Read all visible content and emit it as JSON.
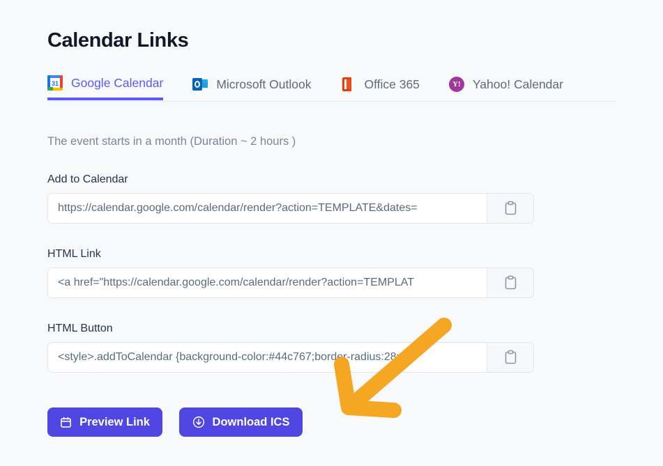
{
  "page": {
    "title": "Calendar Links",
    "background_color": "#f8f9fb",
    "accent_color": "#5b5bf2",
    "button_color": "#5046e4",
    "annotation_color": "#f5a623"
  },
  "tabs": [
    {
      "label": "Google Calendar",
      "icon": "google-calendar-icon",
      "active": true
    },
    {
      "label": "Microsoft Outlook",
      "icon": "microsoft-outlook-icon",
      "active": false
    },
    {
      "label": "Office 365",
      "icon": "office-365-icon",
      "active": false
    },
    {
      "label": "Yahoo! Calendar",
      "icon": "yahoo-calendar-icon",
      "active": false
    }
  ],
  "description": "The event starts in a month (Duration ~ 2 hours )",
  "fields": [
    {
      "label": "Add to Calendar",
      "value": "https://calendar.google.com/calendar/render?action=TEMPLATE&dates=",
      "copy_icon": "clipboard-icon"
    },
    {
      "label": "HTML Link",
      "value": "<a href=\"https://calendar.google.com/calendar/render?action=TEMPLAT",
      "copy_icon": "clipboard-icon"
    },
    {
      "label": "HTML Button",
      "value": "<style>.addToCalendar {background-color:#44c767;border-radius:28px;",
      "copy_icon": "clipboard-icon"
    }
  ],
  "actions": {
    "preview_link": {
      "label": "Preview Link",
      "icon": "calendar-icon"
    },
    "download_ics": {
      "label": "Download ICS",
      "icon": "download-circle-icon"
    }
  },
  "icons": {
    "google_calendar_day": "31",
    "yahoo_mark": "Y!"
  }
}
